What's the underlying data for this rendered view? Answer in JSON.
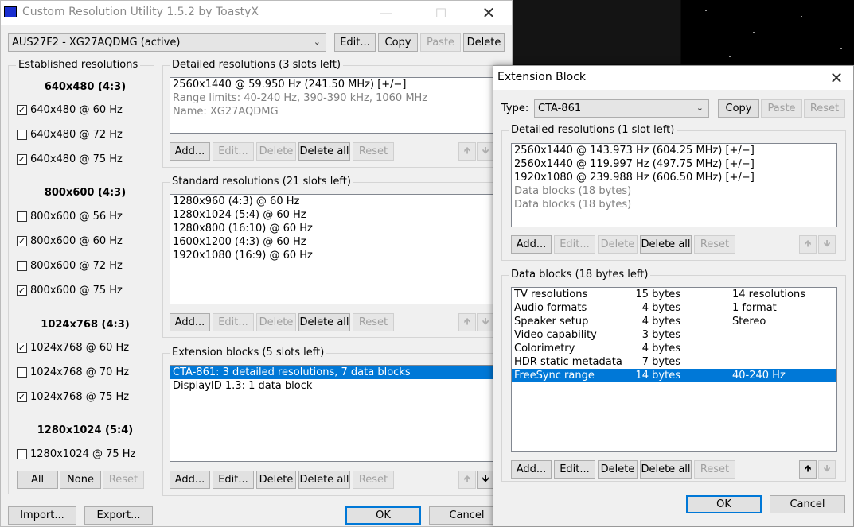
{
  "main": {
    "title": "Custom Resolution Utility 1.5.2 by ToastyX",
    "monitor_select": "AUS27F2 - XG27AQDMG (active)",
    "top_buttons": {
      "edit": "Edit...",
      "copy": "Copy",
      "paste": "Paste",
      "delete": "Delete"
    },
    "established": {
      "label": "Established resolutions",
      "group_640": "640x480 (4:3)",
      "group_800": "800x600 (4:3)",
      "group_1024": "1024x768 (4:3)",
      "group_1280": "1280x1024 (5:4)",
      "items": [
        {
          "label": "640x480 @ 60 Hz",
          "checked": true
        },
        {
          "label": "640x480 @ 72 Hz",
          "checked": false
        },
        {
          "label": "640x480 @ 75 Hz",
          "checked": true
        },
        {
          "label": "800x600 @ 56 Hz",
          "checked": false
        },
        {
          "label": "800x600 @ 60 Hz",
          "checked": true
        },
        {
          "label": "800x600 @ 72 Hz",
          "checked": false
        },
        {
          "label": "800x600 @ 75 Hz",
          "checked": true
        },
        {
          "label": "1024x768 @ 60 Hz",
          "checked": true
        },
        {
          "label": "1024x768 @ 70 Hz",
          "checked": false
        },
        {
          "label": "1024x768 @ 75 Hz",
          "checked": true
        },
        {
          "label": "1280x1024 @ 75 Hz",
          "checked": false
        }
      ],
      "all": "All",
      "none": "None",
      "reset": "Reset"
    },
    "detailed": {
      "label": "Detailed resolutions (3 slots left)",
      "items": [
        "2560x1440 @ 59.950 Hz (241.50 MHz) [+/−]",
        "Range limits: 40-240 Hz, 390-390 kHz, 1060 MHz",
        "Name: XG27AQDMG"
      ]
    },
    "standard": {
      "label": "Standard resolutions (21 slots left)",
      "items": [
        "1280x960 (4:3) @ 60 Hz",
        "1280x1024 (5:4) @ 60 Hz",
        "1280x800 (16:10) @ 60 Hz",
        "1600x1200 (4:3) @ 60 Hz",
        "1920x1080 (16:9) @ 60 Hz"
      ]
    },
    "extension": {
      "label": "Extension blocks (5 slots left)",
      "items": [
        "CTA-861: 3 detailed resolutions, 7 data blocks",
        "DisplayID 1.3: 1 data block"
      ]
    },
    "list_buttons": {
      "add": "Add...",
      "edit": "Edit...",
      "delete": "Delete",
      "delete_all": "Delete all",
      "reset": "Reset"
    },
    "import": "Import...",
    "export": "Export...",
    "ok": "OK",
    "cancel": "Cancel"
  },
  "ext": {
    "title": "Extension Block",
    "type_label": "Type:",
    "type_value": "CTA-861",
    "copy": "Copy",
    "paste": "Paste",
    "reset": "Reset",
    "detailed_label": "Detailed resolutions (1 slot left)",
    "detailed_items": [
      "2560x1440 @ 143.973 Hz (604.25 MHz) [+/−]",
      "2560x1440 @ 119.997 Hz (497.75 MHz) [+/−]",
      "1920x1080 @ 239.988 Hz (606.50 MHz) [+/−]",
      "Data blocks (18 bytes)",
      "Data blocks (18 bytes)"
    ],
    "data_label": "Data blocks (18 bytes left)",
    "data_rows": [
      [
        "TV resolutions",
        "15 bytes",
        "14 resolutions"
      ],
      [
        "Audio formats",
        "4 bytes",
        "1 format"
      ],
      [
        "Speaker setup",
        "4 bytes",
        "Stereo"
      ],
      [
        "Video capability",
        "3 bytes",
        ""
      ],
      [
        "Colorimetry",
        "4 bytes",
        ""
      ],
      [
        "HDR static metadata",
        "7 bytes",
        ""
      ],
      [
        "FreeSync range",
        "14 bytes",
        "40-240 Hz"
      ]
    ],
    "ok": "OK",
    "cancel": "Cancel"
  },
  "colors": {
    "selection": "#0078d7",
    "window_bg": "#f0f0f0"
  }
}
